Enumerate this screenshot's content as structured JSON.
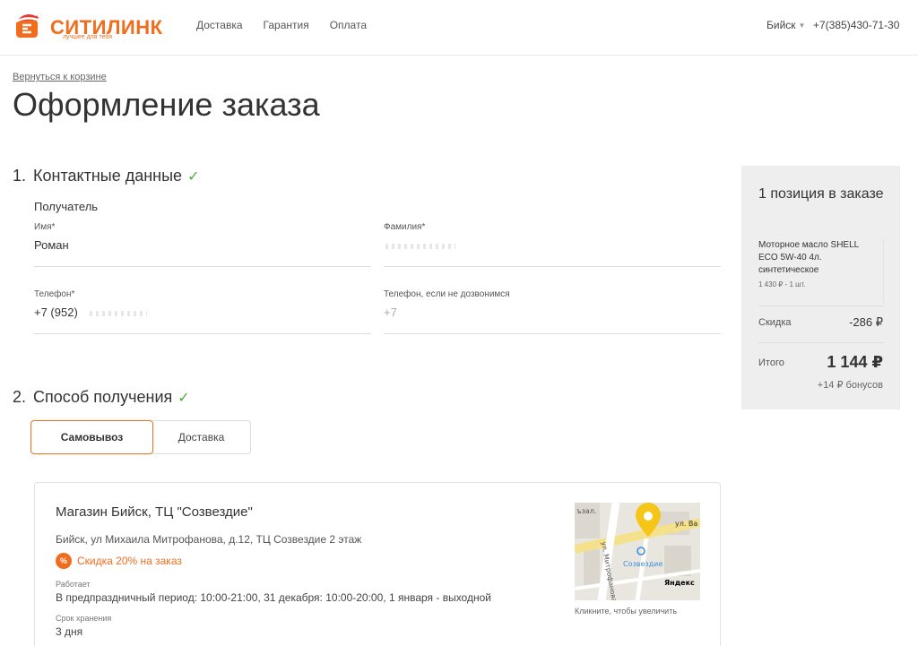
{
  "header": {
    "logo_text": "СИТИЛИНК",
    "logo_tagline": "лучшее для тебя",
    "nav": [
      "Доставка",
      "Гарантия",
      "Оплата"
    ],
    "city": "Бийск",
    "phone": "+7(385)430-71-30"
  },
  "page": {
    "back_link": "Вернуться к корзине",
    "title": "Оформление заказа"
  },
  "contacts": {
    "number": "1.",
    "title": "Контактные данные",
    "subhead": "Получатель",
    "first_name_label": "Имя*",
    "first_name_value": "Роман",
    "last_name_label": "Фамилия*",
    "phone_label": "Телефон*",
    "phone_value": "+7 (952)",
    "alt_phone_label": "Телефон, если не дозвонимся",
    "alt_phone_value": "+7"
  },
  "delivery": {
    "number": "2.",
    "title": "Способ получения",
    "tabs": [
      "Самовывоз",
      "Доставка"
    ],
    "active_tab": "Самовывоз"
  },
  "store": {
    "name": "Магазин Бийск, ТЦ \"Созвездие\"",
    "address": "Бийск, ул Михаила Митрофанова, д.12, ТЦ Созвездие 2 этаж",
    "discount": "Скидка 20% на заказ",
    "discount_badge": "%",
    "hours_label": "Работает",
    "hours": "В предпраздничный период: 10:00-21:00, 31 декабря: 10:00-20:00, 1 января - выходной",
    "storage_label": "Срок хранения",
    "storage": "3 дня",
    "map_caption": "Кликните, чтобы увеличить",
    "map_labels": {
      "street1": "ул. Ва",
      "street2": "ул. Митрофанова",
      "street3": "ъзал.",
      "poi": "Созвездие",
      "brand": "Яндекс"
    }
  },
  "summary": {
    "title": "1 позиция в заказе",
    "item_name": "Моторное масло SHELL ECO 5W-40 4л. синтетическое",
    "item_price": "1 430 ₽ - 1 шт.",
    "discount_label": "Скидка",
    "discount_value": "-286 ₽",
    "total_label": "Итого",
    "total_value": "1 144 ₽",
    "bonus": "+14 ₽ бонусов"
  },
  "colors": {
    "accent": "#f26c1d",
    "check": "#4cad3c",
    "summary_bg": "#eeeeee"
  }
}
